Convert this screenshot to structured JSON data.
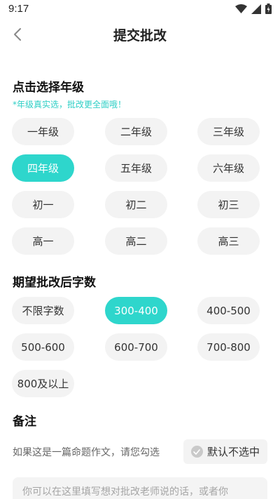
{
  "status_bar": {
    "time": "9:17"
  },
  "nav": {
    "title": "提交批改"
  },
  "grade_section": {
    "title": "点击选择年级",
    "hint": "*年级真实选，批改更全面哦！",
    "options": [
      "一年级",
      "二年级",
      "三年级",
      "四年级",
      "五年级",
      "六年级",
      "初一",
      "初二",
      "初三",
      "高一",
      "高二",
      "高三"
    ],
    "selected": "四年级"
  },
  "word_count_section": {
    "title": "期望批改后字数",
    "options": [
      "不限字数",
      "300-400",
      "400-500",
      "500-600",
      "600-700",
      "700-800",
      "800及以上"
    ],
    "selected": "300-400"
  },
  "remarks_section": {
    "title": "备注",
    "prompt": "如果这是一篇命题作文，请您勾选",
    "default_button": "默认不选中",
    "placeholder": "你可以在这里填写想对批改老师说的话，或者你"
  },
  "colors": {
    "accent": "#2ed6cc",
    "hint": "#2fcfc6",
    "chip_bg": "#f3f3f3"
  }
}
